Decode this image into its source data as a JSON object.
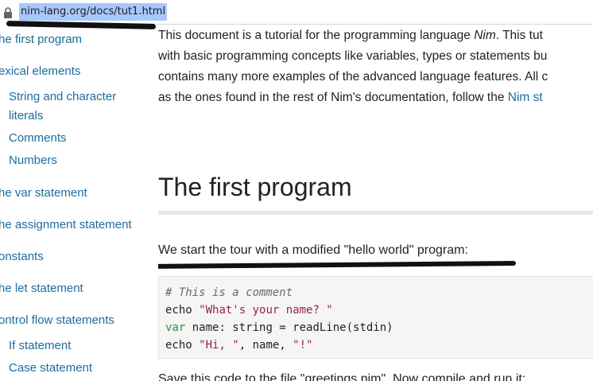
{
  "address_bar": {
    "url": "nim-lang.org/docs/tut1.html",
    "lock_icon": "lock-icon"
  },
  "sidebar": {
    "items": [
      {
        "label": "he first program",
        "indent": 0
      },
      {
        "label": "exical elements",
        "indent": 0
      },
      {
        "label": "String and character",
        "indent": 1
      },
      {
        "label": "literals",
        "indent": 1
      },
      {
        "label": "Comments",
        "indent": 1
      },
      {
        "label": "Numbers",
        "indent": 1
      },
      {
        "label": "he var statement",
        "indent": 0
      },
      {
        "label": "he assignment statement",
        "indent": 0
      },
      {
        "label": "onstants",
        "indent": 0
      },
      {
        "label": "he let statement",
        "indent": 0
      },
      {
        "label": "ontrol flow statements",
        "indent": 0
      },
      {
        "label": "If statement",
        "indent": 1
      },
      {
        "label": "Case statement",
        "indent": 1
      }
    ]
  },
  "main": {
    "intro": {
      "line1_a": "This document is a tutorial for the programming language ",
      "line1_em": "Nim",
      "line1_b": ". This tut",
      "line2": "with basic programming concepts like variables, types or statements bu",
      "line3": "contains many more examples of the advanced language features. All c",
      "line4_a": "as the ones found in the rest of Nim's documentation, follow the ",
      "line4_link": "Nim st"
    },
    "heading": "The first program",
    "lead": "We start the tour with a modified \"hello world\" program:",
    "code": {
      "comment": "# This is a comment",
      "l2_fn": "echo ",
      "l2_str": "\"What's your name? \"",
      "l3_kw": "var",
      "l3_rest": " name: string = readLine(stdin)",
      "l4_fn": "echo ",
      "l4_str1": "\"Hi, \"",
      "l4_mid": ", name, ",
      "l4_str2": "\"!\""
    },
    "tail": "Save this code to the file \"greetings.nim\". Now compile and run it:"
  },
  "colors": {
    "link": "#1a6d9c",
    "text": "#222222",
    "code_bg": "#f5f5f5",
    "url_highlight": "#a8c7fa",
    "string": "#9c1f52",
    "keyword": "#2f8f3f",
    "comment": "#6a6a6a"
  }
}
